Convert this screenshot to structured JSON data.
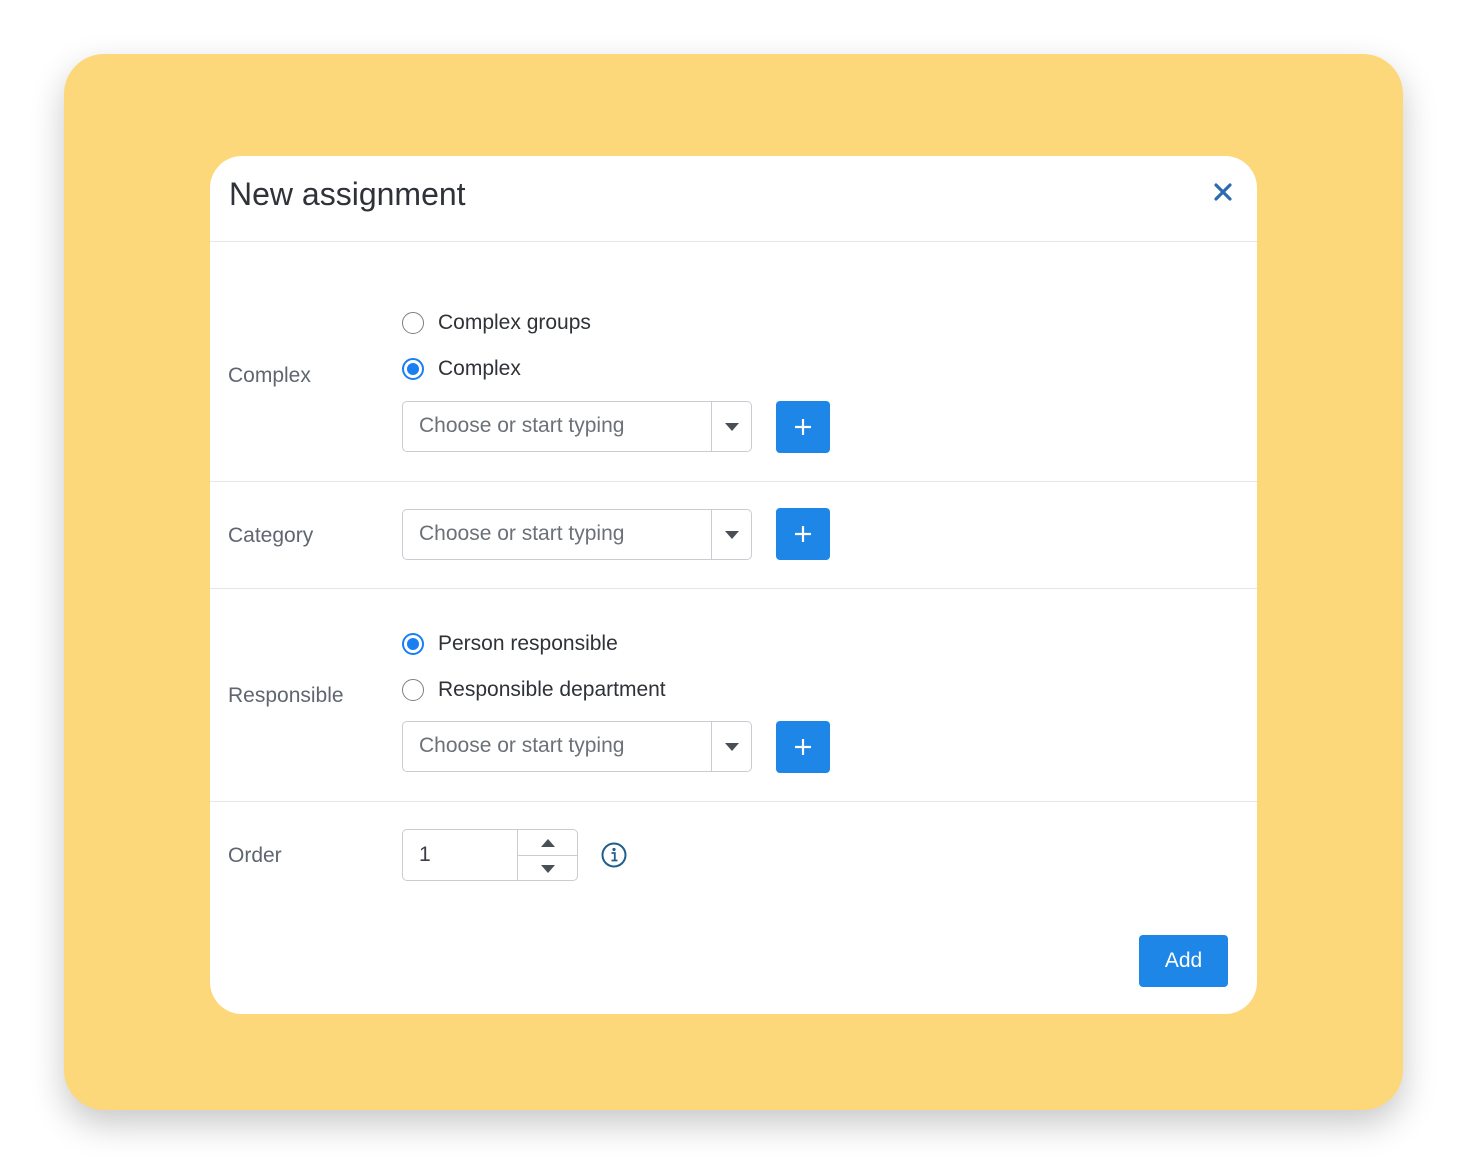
{
  "modal": {
    "title": "New assignment",
    "close_icon": "close-icon"
  },
  "complex": {
    "label": "Complex",
    "options": [
      {
        "label": "Complex groups",
        "checked": false
      },
      {
        "label": "Complex",
        "checked": true
      }
    ],
    "select_placeholder": "Choose or start typing",
    "add_icon": "plus-icon"
  },
  "category": {
    "label": "Category",
    "select_placeholder": "Choose or start typing",
    "add_icon": "plus-icon"
  },
  "responsible": {
    "label": "Responsible",
    "options": [
      {
        "label": "Person responsible",
        "checked": true
      },
      {
        "label": "Responsible department",
        "checked": false
      }
    ],
    "select_placeholder": "Choose or start typing",
    "add_icon": "plus-icon"
  },
  "order": {
    "label": "Order",
    "value": "1",
    "info_icon": "info-icon"
  },
  "footer": {
    "add_label": "Add"
  },
  "colors": {
    "backdrop": "#fdd87a",
    "accent": "#1d86e6",
    "radio_checked": "#1a7ff0",
    "close_icon": "#2b6cb0"
  }
}
